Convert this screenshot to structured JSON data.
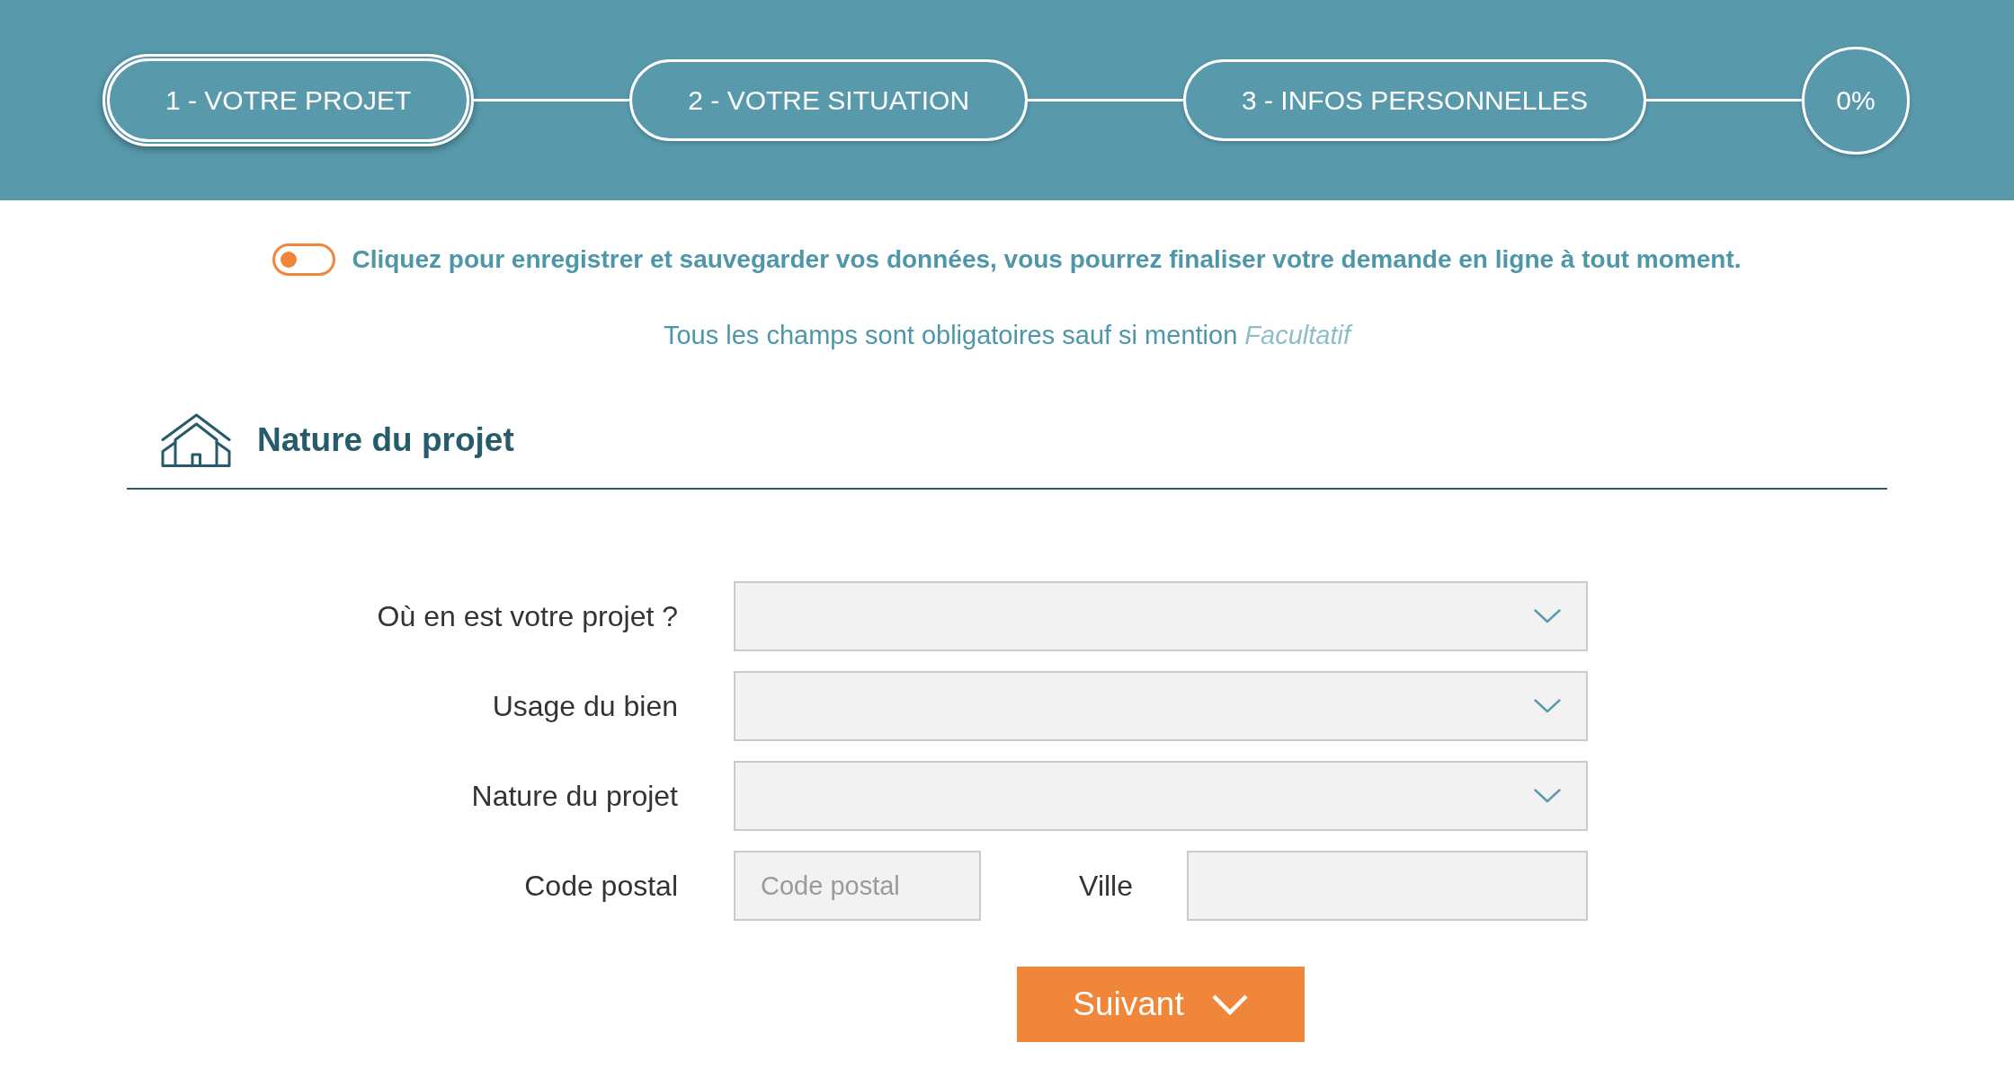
{
  "steps": [
    {
      "label": "1 - VOTRE PROJET",
      "selected": true
    },
    {
      "label": "2 - VOTRE SITUATION",
      "selected": false
    },
    {
      "label": "3 - INFOS PERSONNELLES",
      "selected": false
    }
  ],
  "progress": {
    "label": "0%"
  },
  "save_toggle": {
    "on": false,
    "label": "Cliquez pour enregistrer et sauvegarder vos données, vous pourrez finaliser votre demande en ligne à tout moment."
  },
  "required_note": "Tous les champs sont obligatoires sauf si mention *Facultatif*",
  "section": {
    "title": "Nature du projet"
  },
  "fields": [
    {
      "kind": "select",
      "label": "Où en est votre projet ?"
    },
    {
      "kind": "select",
      "label": "Usage du bien"
    },
    {
      "kind": "select",
      "label": "Nature du projet"
    },
    {
      "kind": "postal_city",
      "label": "Code postal",
      "placeholder": "Code postal",
      "city_label": "Ville"
    }
  ],
  "next_button": {
    "label": "Suivant"
  }
}
